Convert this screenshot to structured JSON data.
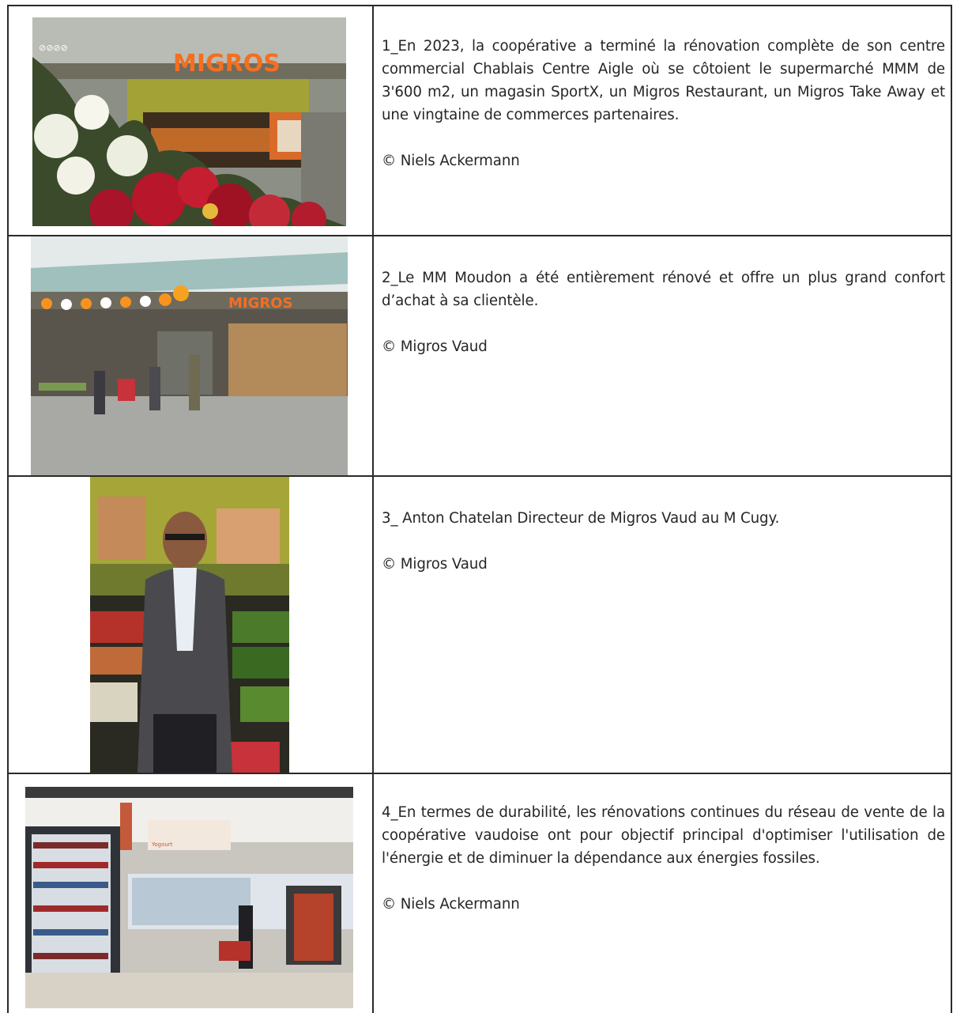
{
  "rows": [
    {
      "caption": "1_En 2023, la coopérative a terminé la rénovation complète de son centre commercial Chablais Centre Aigle où se côtoient le supermarché MMM de 3'600 m2, un magasin SportX, un Migros Restaurant, un Migros Take Away et une vingtaine de commerces partenaires.",
      "credit": "© Niels Ackermann",
      "photo_sign": "MIGROS"
    },
    {
      "caption": "2_Le MM Moudon a été entièrement rénové et offre un plus grand confort d’achat à sa clientèle.",
      "credit": "© Migros Vaud",
      "photo_sign": "MIGROS"
    },
    {
      "caption": "3_ Anton Chatelan Directeur de Migros Vaud au M Cugy.",
      "credit": "© Migros Vaud"
    },
    {
      "caption": "4_En termes de durabilité, les rénovations continues du réseau de vente de la coopérative vaudoise ont pour objectif principal d'optimiser l'utilisation de l'énergie et de diminuer la dépendance aux énergies fossiles.",
      "credit": "© Niels Ackermann",
      "photo_sign": "Yogourt"
    }
  ],
  "colors": {
    "migros_orange": "#f36f21",
    "border": "#2a2a2a"
  }
}
